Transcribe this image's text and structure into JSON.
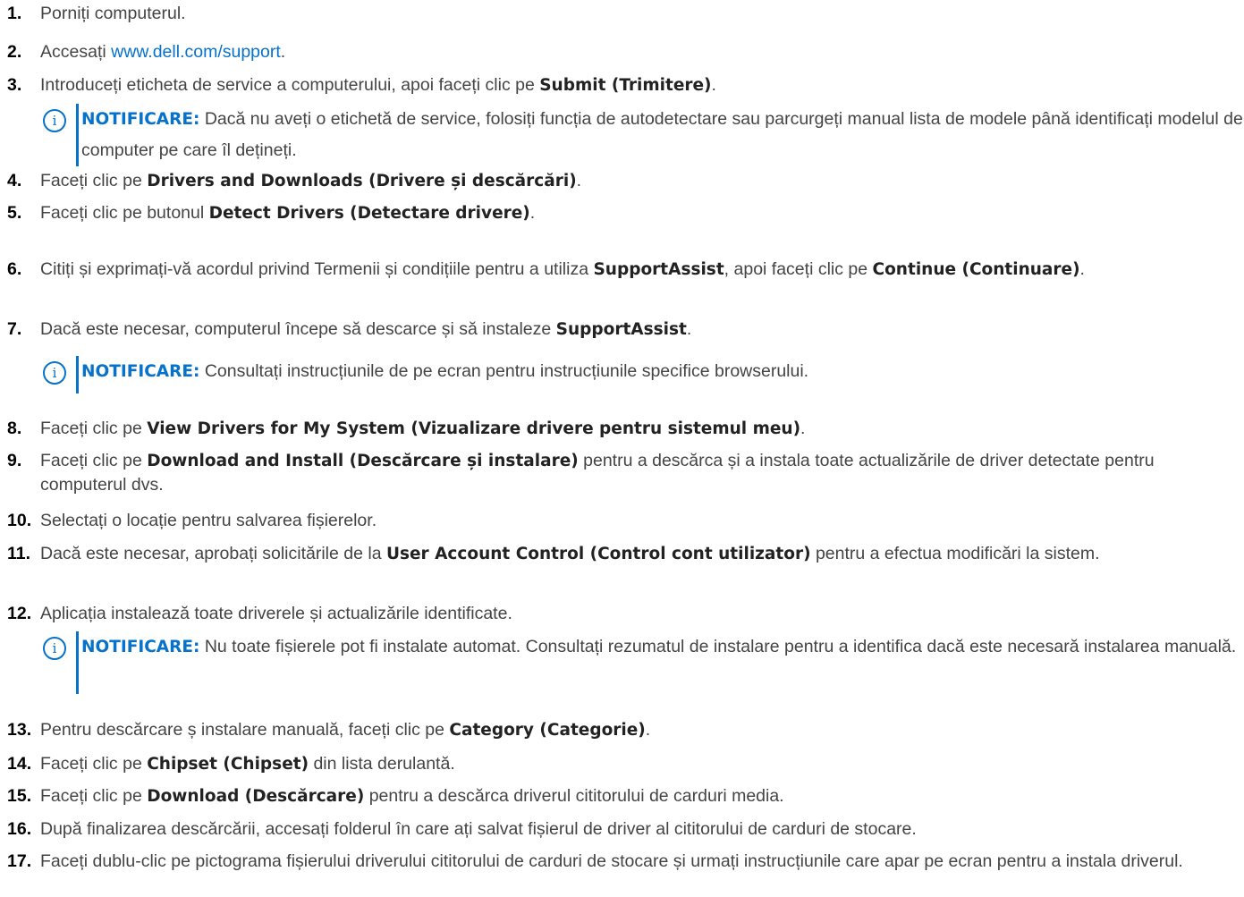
{
  "steps": [
    {
      "n": "1.",
      "text": "Porniți computerul."
    },
    {
      "n": "2.",
      "pre": "Accesați ",
      "link": "www.dell.com/support",
      "post": "."
    },
    {
      "n": "3.",
      "pre": "Introduceți eticheta de service a computerului, apoi faceți clic pe ",
      "b": "Submit (Trimitere)",
      "post": "."
    },
    {
      "n": "4.",
      "pre": "Faceți clic pe ",
      "b": "Drivers and Downloads (Drivere și descărcări)",
      "post": "."
    },
    {
      "n": "5.",
      "pre": "Faceți clic pe butonul ",
      "b": "Detect Drivers (Detectare drivere)",
      "post": "."
    },
    {
      "n": "6.",
      "pre": "Citiți și exprimați-vă acordul privind Termenii și condițiile pentru a utiliza ",
      "b": "SupportAssist",
      "mid": ", apoi faceți clic pe ",
      "b2": "Continue (Continuare)",
      "post": "."
    },
    {
      "n": "7.",
      "pre": "Dacă este necesar, computerul începe să descarce și să instaleze ",
      "b": "SupportAssist",
      "post": "."
    },
    {
      "n": "8.",
      "pre": "Faceți clic pe ",
      "b": "View Drivers for My System (Vizualizare drivere pentru sistemul meu)",
      "post": "."
    },
    {
      "n": "9.",
      "pre": "Faceți clic pe ",
      "b": "Download and Install (Descărcare și instalare)",
      "post": " pentru a descărca și a instala toate actualizările de driver detectate pentru computerul dvs."
    },
    {
      "n": "10.",
      "pre": "Selectați o locație pentru salvarea fișierelor."
    },
    {
      "n": "11.",
      "pre": "Dacă este necesar, aprobați solicitările de la ",
      "b": "User Account Control (Control cont utilizator)",
      "post": " pentru a efectua modificări la sistem."
    },
    {
      "n": "12.",
      "pre": "Aplicația instalează toate driverele și actualizările identificate."
    },
    {
      "n": "13.",
      "pre": "Pentru descărcare ș instalare manuală, faceți clic pe ",
      "b": "Category (Categorie)",
      "post": "."
    },
    {
      "n": "14.",
      "pre": "Faceți clic pe ",
      "b": "Chipset (Chipset)",
      "post": " din lista derulantă."
    },
    {
      "n": "15.",
      "pre": "Faceți clic pe ",
      "b": "Download (Descărcare)",
      "post": " pentru a descărca driverul cititorului de carduri media."
    },
    {
      "n": "16.",
      "pre": "După finalizarea descărcării, accesați folderul în care ați salvat fișierul de driver al cititorului de carduri de stocare."
    },
    {
      "n": "17.",
      "pre": "Faceți dublu-clic pe pictograma fișierului driverului cititorului de carduri de stocare și urmați instrucțiunile care apar pe ecran pentru a instala driverul."
    }
  ],
  "notes": [
    {
      "label": "NOTIFICARE:",
      "text": " Dacă nu aveți o etichetă de service, folosiți funcția de autodetectare sau parcurgeți manual lista de modele până identificați modelul de computer pe care îl dețineți."
    },
    {
      "label": "NOTIFICARE:",
      "text": " Consultați instrucțiunile de pe ecran pentru instrucțiunile specifice browserului."
    },
    {
      "label": "NOTIFICARE:",
      "text": " Nu toate fișierele pot fi instalate automat. Consultați rezumatul de instalare pentru a identifica dacă este necesară instalarea manuală."
    }
  ],
  "note_icon_glyph": "i",
  "link_color": "#0672cb",
  "note_accent_color": "#0672cb"
}
